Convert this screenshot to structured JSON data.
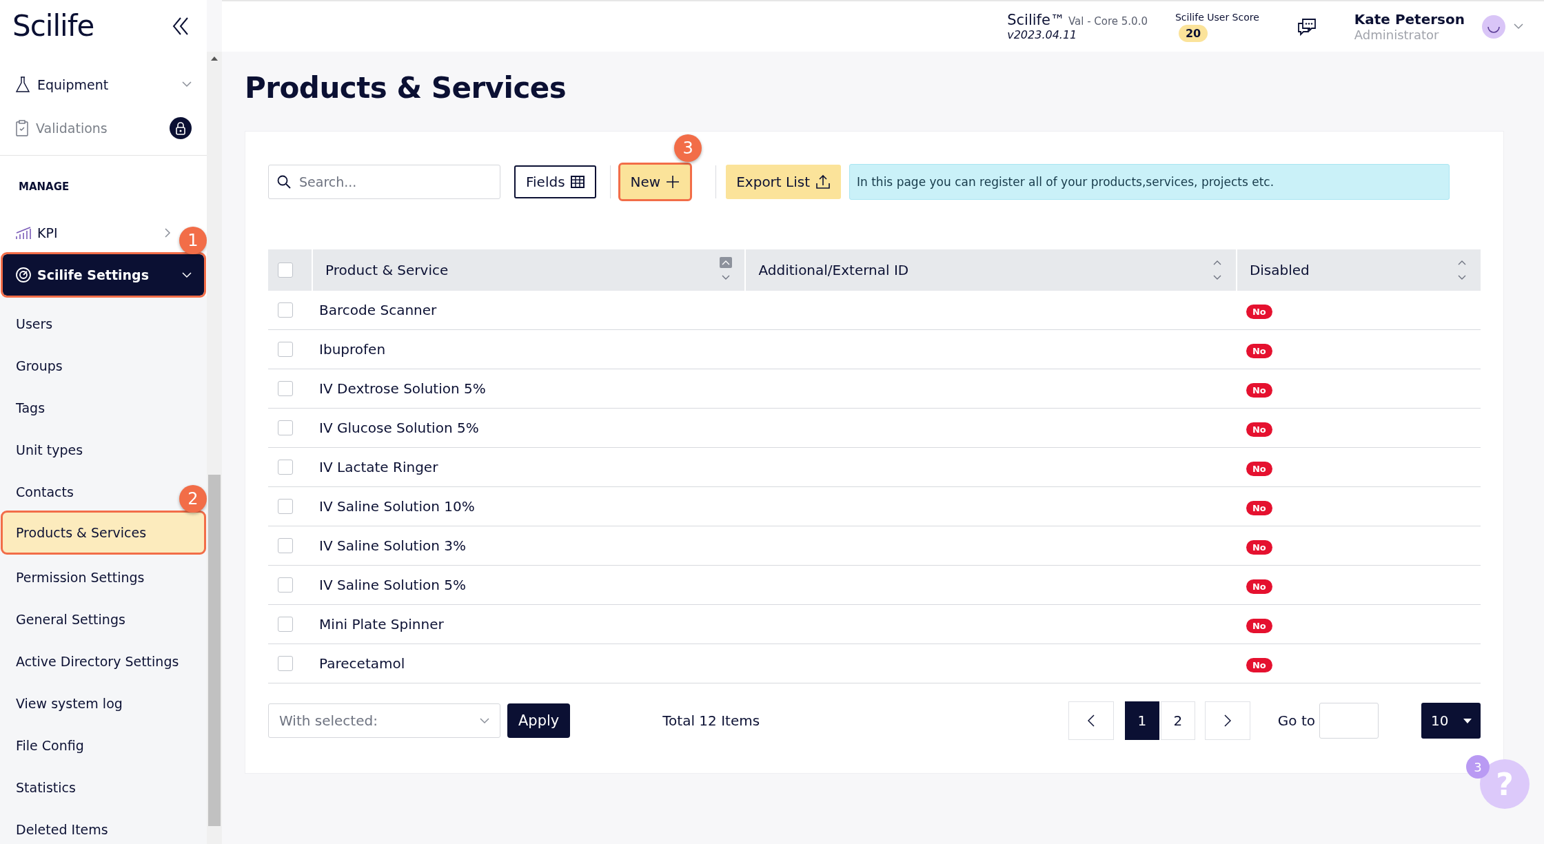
{
  "sidebar": {
    "logo": "Scilife",
    "top_items": [
      {
        "label": "Equipment",
        "kind": "dropdown",
        "disabled": false
      },
      {
        "label": "Validations",
        "kind": "locked",
        "disabled": true
      }
    ],
    "section": "MANAGE",
    "items": [
      {
        "label": "KPI",
        "kind": "chart",
        "selected": false,
        "expanded": false
      },
      {
        "label": "Scilife Settings",
        "kind": "gear",
        "selected": true,
        "expanded": true,
        "callout": "1",
        "children": [
          {
            "label": "Users",
            "selected": false
          },
          {
            "label": "Groups",
            "selected": false
          },
          {
            "label": "Tags",
            "selected": false
          },
          {
            "label": "Unit types",
            "selected": false
          },
          {
            "label": "Contacts",
            "selected": false
          },
          {
            "label": "Products & Services",
            "selected": true,
            "callout": "2"
          },
          {
            "label": "Permission Settings",
            "selected": false
          },
          {
            "label": "General Settings",
            "selected": false
          },
          {
            "label": "Active Directory Settings",
            "selected": false
          },
          {
            "label": "View system log",
            "selected": false
          },
          {
            "label": "File Config",
            "selected": false
          },
          {
            "label": "Statistics",
            "selected": false
          },
          {
            "label": "Deleted Items",
            "selected": false
          }
        ]
      }
    ]
  },
  "header": {
    "product": "Scilife™",
    "edition": "Val - Core 5.0.0",
    "version": "v2023.04.11",
    "score_label": "Scilife User Score",
    "score": "20",
    "user_name": "Kate Peterson",
    "user_role": "Administrator"
  },
  "page_title": "Products & Services",
  "toolbar": {
    "search": {
      "placeholder": "Search..."
    },
    "buttons": [
      {
        "label": "Fields",
        "kind": "fields"
      },
      {
        "label": "New",
        "kind": "new",
        "callout": "3"
      },
      {
        "label": "Export List",
        "kind": "export"
      }
    ],
    "info": "In this page you can register all of your products,services, projects etc."
  },
  "table": {
    "columns": [
      {
        "label": "Product & Service",
        "sorted": true
      },
      {
        "label": "Additional/External ID",
        "sorted": false
      },
      {
        "label": "Disabled",
        "sorted": false
      }
    ],
    "header_checked": false,
    "rows": [
      {
        "name": "Barcode Scanner",
        "disabled": "No",
        "checked": false
      },
      {
        "name": "Ibuprofen",
        "disabled": "No",
        "checked": false
      },
      {
        "name": "IV Dextrose Solution 5%",
        "disabled": "No",
        "checked": false
      },
      {
        "name": "IV Glucose Solution 5%",
        "disabled": "No",
        "checked": false
      },
      {
        "name": "IV Lactate Ringer",
        "disabled": "No",
        "checked": false
      },
      {
        "name": "IV Saline Solution 10%",
        "disabled": "No",
        "checked": false
      },
      {
        "name": "IV Saline Solution 3%",
        "disabled": "No",
        "checked": false
      },
      {
        "name": "IV Saline Solution 5%",
        "disabled": "No",
        "checked": false
      },
      {
        "name": "Mini Plate Spinner",
        "disabled": "No",
        "checked": false
      },
      {
        "name": "Parecetamol",
        "disabled": "No",
        "checked": false
      }
    ]
  },
  "footer": {
    "bulk": {
      "placeholder": "With selected:"
    },
    "apply": "Apply",
    "total": "Total 12 Items",
    "pages": [
      {
        "label": "1",
        "selected": true
      },
      {
        "label": "2",
        "selected": false
      }
    ],
    "goto_label": "Go to",
    "page_size": "10"
  },
  "help": {
    "badge": "3",
    "glyph": "?"
  }
}
